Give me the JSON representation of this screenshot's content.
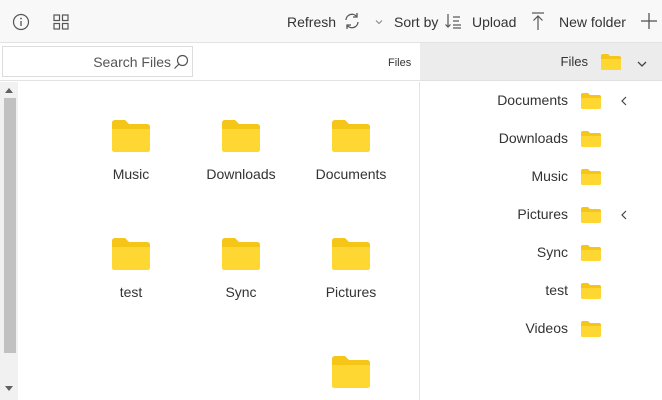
{
  "toolbar": {
    "refresh_label": "Refresh",
    "sortby_label": "Sort by",
    "upload_label": "Upload",
    "newfolder_label": "New folder"
  },
  "search": {
    "placeholder": "Search Files"
  },
  "breadcrumb": {
    "label": "Files"
  },
  "nav_header": {
    "label": "Files"
  },
  "files": [
    {
      "name": "Music"
    },
    {
      "name": "Downloads"
    },
    {
      "name": "Documents"
    },
    {
      "name": "test"
    },
    {
      "name": "Sync"
    },
    {
      "name": "Pictures"
    },
    {
      "name": ""
    }
  ],
  "tree": [
    {
      "label": "Documents",
      "expandable": true
    },
    {
      "label": "Downloads",
      "expandable": false
    },
    {
      "label": "Music",
      "expandable": false
    },
    {
      "label": "Pictures",
      "expandable": true
    },
    {
      "label": "Sync",
      "expandable": false
    },
    {
      "label": "test",
      "expandable": false
    },
    {
      "label": "Videos",
      "expandable": false
    }
  ],
  "colors": {
    "folder": "#FFD733",
    "folder_back": "#F5C518",
    "toolbar_bg": "#f8f8f8",
    "nav_header_bg": "#ececec"
  }
}
